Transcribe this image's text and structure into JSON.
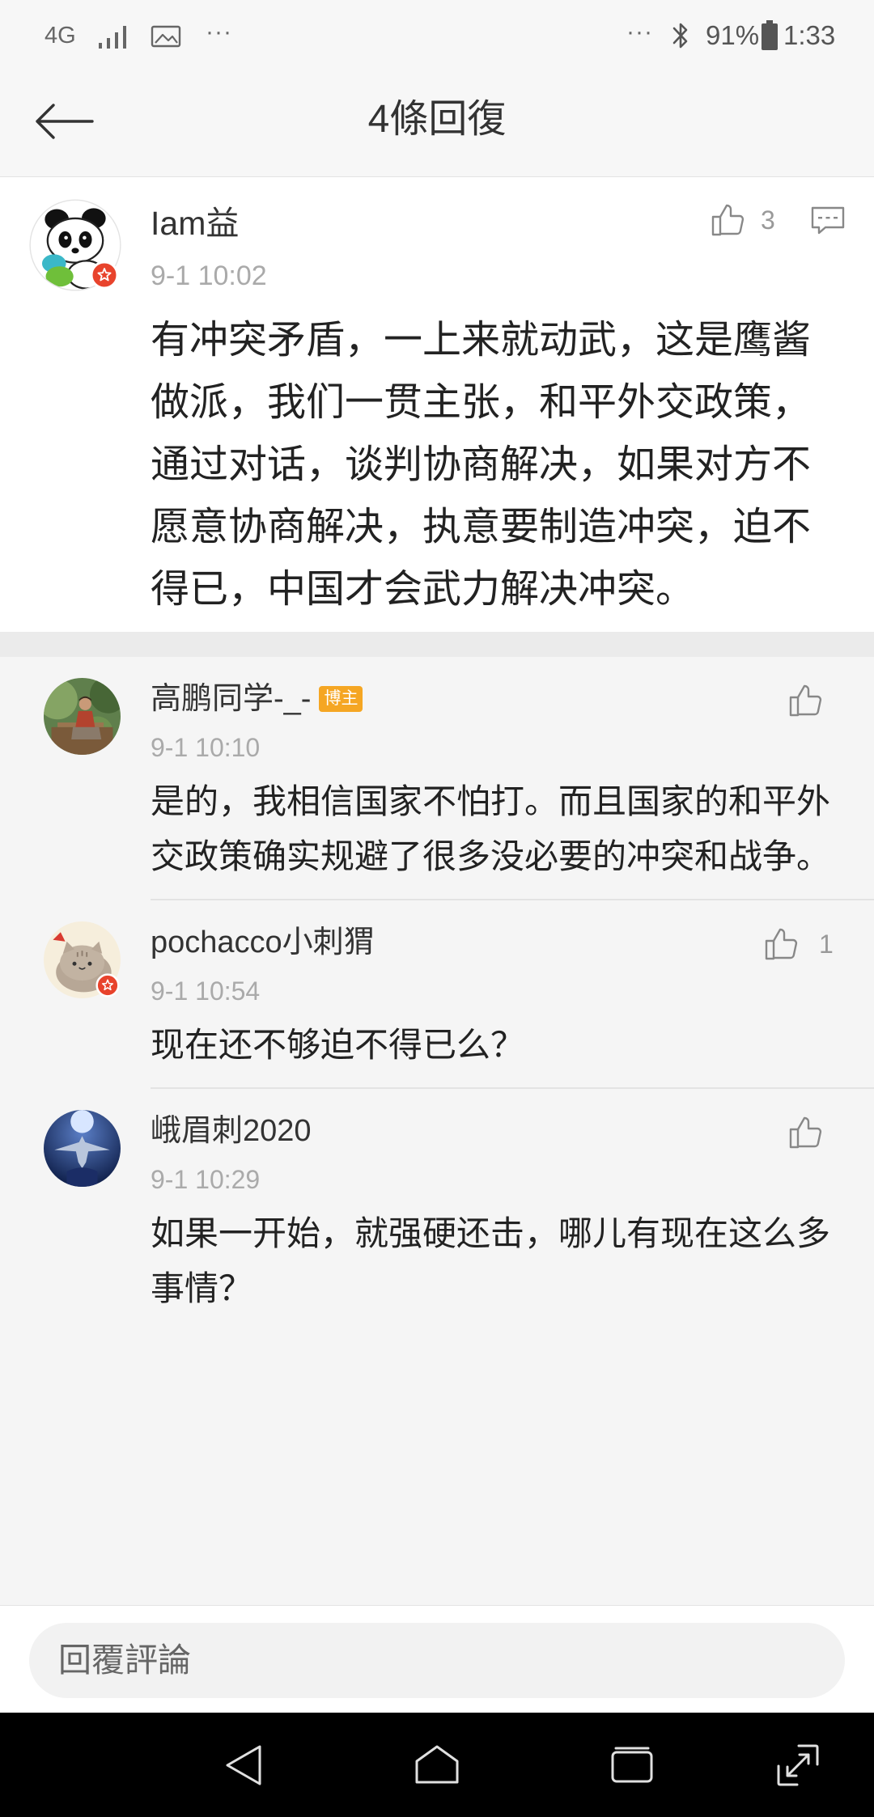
{
  "status_bar": {
    "network": "4G",
    "left_more": "···",
    "right_more": "···",
    "battery_percent": "91%",
    "time": "1:33",
    "icons": {
      "signal": "signal-icon",
      "gallery": "image-icon",
      "bluetooth": "bluetooth-icon",
      "battery": "battery-icon"
    }
  },
  "header": {
    "title": "4條回復",
    "back_icon": "arrow-left-icon"
  },
  "main_comment": {
    "username": "Iam益",
    "time": "9-1 10:02",
    "like_count": "3",
    "text": "有冲突矛盾，一上来就动武，这是鹰酱做派，我们一贯主张，和平外交政策，通过对话，谈判协商解决，如果对方不愿意协商解决，执意要制造冲突，迫不得已，中国才会武力解决冲突。",
    "icons": {
      "like": "thumbs-up-icon",
      "reply": "comment-icon",
      "rank_badge": "star-badge-icon"
    }
  },
  "replies": [
    {
      "username": "高鹏同学-_-",
      "badge": "博主",
      "time": "9-1 10:10",
      "text": "是的，我相信国家不怕打。而且国家的和平外交政策确实规避了很多没必要的冲突和战争。"
    },
    {
      "username": "pochacco小刺猬",
      "time": "9-1 10:54",
      "like_count": "1",
      "text": "现在还不够迫不得已么？"
    },
    {
      "username": "峨眉刺2020",
      "time": "9-1 10:29",
      "text": "如果一开始，就强硬还击，哪儿有现在这么多事情？"
    }
  ],
  "reply_input": {
    "placeholder": "回覆評論"
  },
  "nav_bar": {
    "icons": [
      "back-icon",
      "home-icon",
      "recents-icon",
      "expand-icon"
    ]
  },
  "colors": {
    "blogger_badge": "#f5a623",
    "rank_badge": "#e8432c",
    "page_background": "#f5f5f5",
    "nav_bar": "#000000"
  }
}
